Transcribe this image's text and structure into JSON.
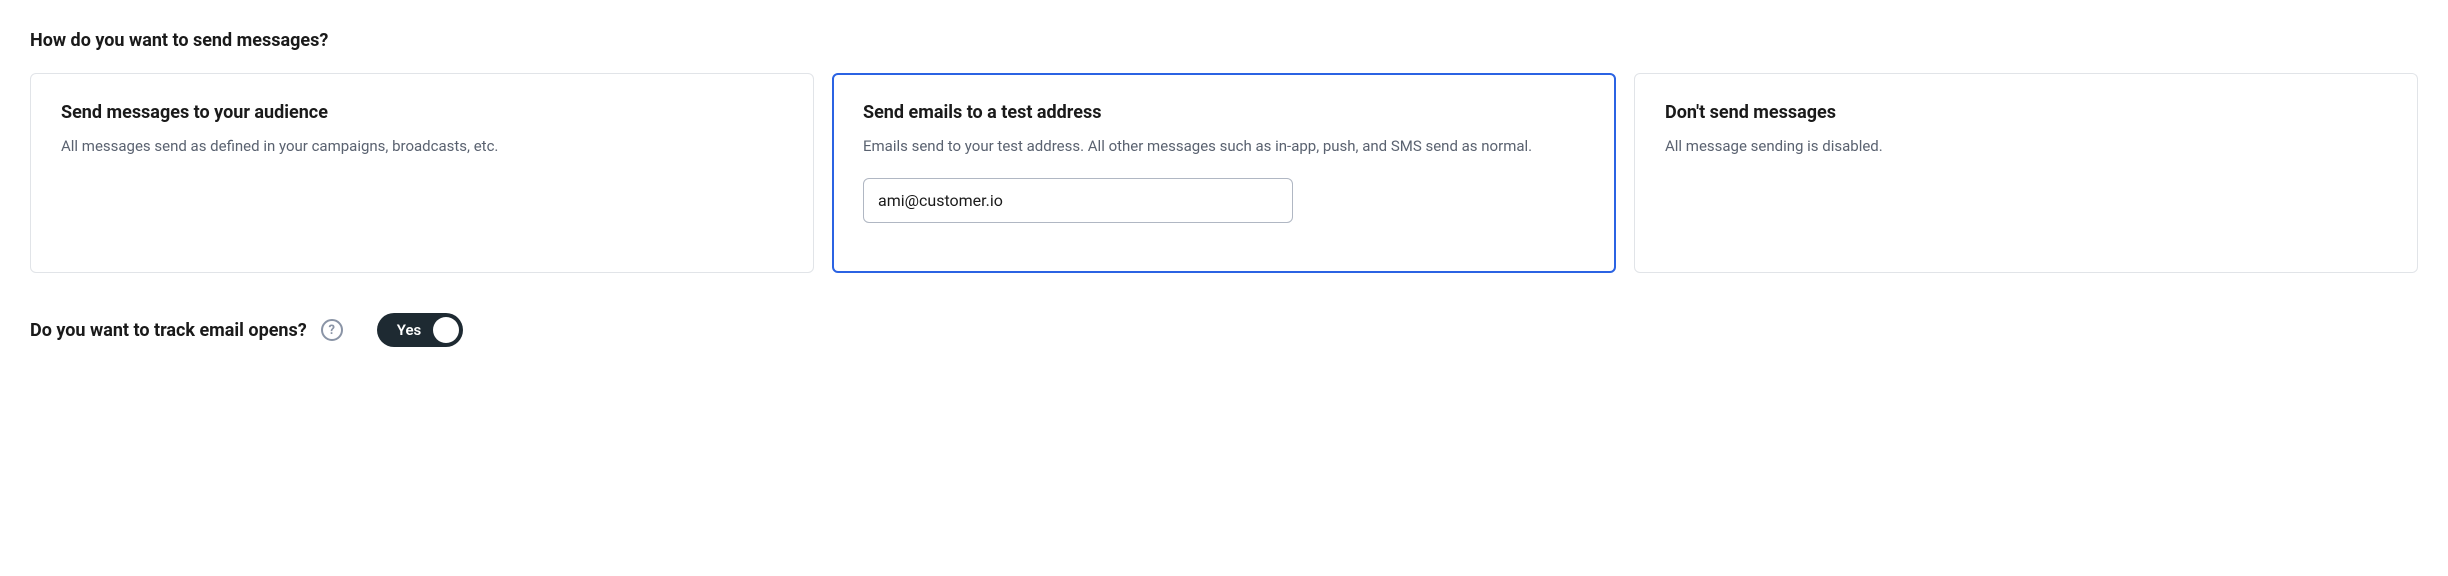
{
  "heading": "How do you want to send messages?",
  "cards": [
    {
      "title": "Send messages to your audience",
      "description": "All messages send as defined in your campaigns, broadcasts, etc."
    },
    {
      "title": "Send emails to a test address",
      "description": "Emails send to your test address. All other messages such as in-app, push, and SMS send as normal.",
      "email_value": "ami@customer.io"
    },
    {
      "title": "Don't send messages",
      "description": "All message sending is disabled."
    }
  ],
  "track": {
    "label": "Do you want to track email opens?",
    "help": "?",
    "toggle_text": "Yes"
  }
}
